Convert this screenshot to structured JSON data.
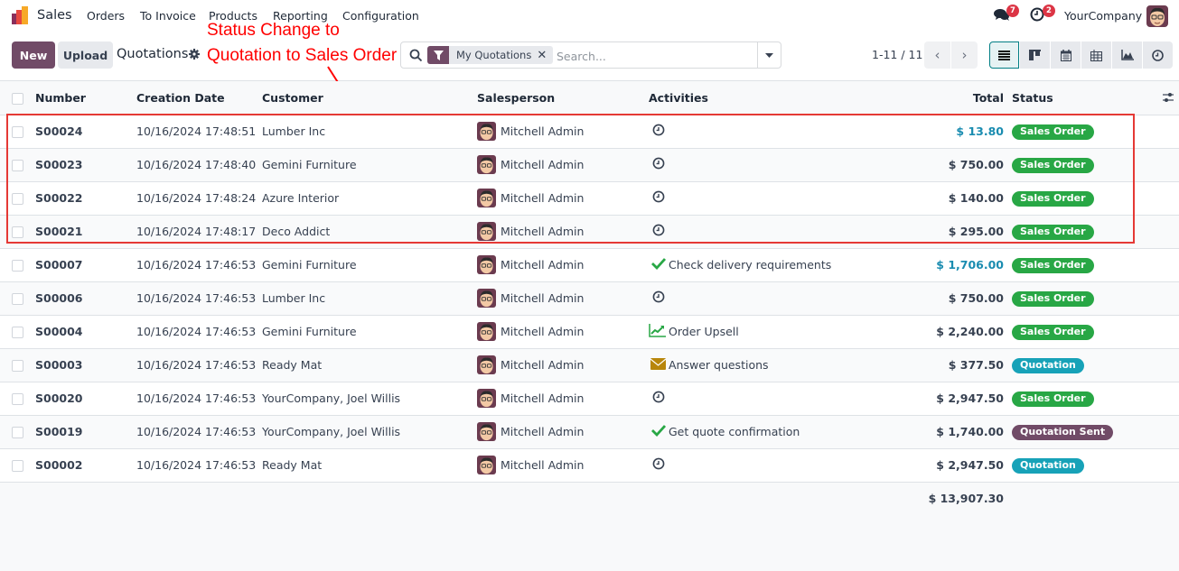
{
  "topbar": {
    "app_name": "Sales",
    "menu": [
      "Orders",
      "To Invoice",
      "Products",
      "Reporting",
      "Configuration"
    ],
    "messages_badge": "7",
    "activities_badge": "2",
    "company": "YourCompany",
    "icons": [
      "app-logo-icon",
      "chat-icon",
      "clock-icon",
      "user-avatar"
    ]
  },
  "control": {
    "new_label": "New",
    "upload_label": "Upload",
    "breadcrumb": "Quotations",
    "search": {
      "facet_label": "My Quotations",
      "facet_close": "✕",
      "placeholder": "Search..."
    },
    "pager": "1-11 / 11",
    "pager_prev": "‹",
    "pager_next": "›",
    "views": [
      "list",
      "kanban",
      "calendar",
      "pivot",
      "graph",
      "activity"
    ],
    "active_view": "list"
  },
  "annotation": {
    "line1": "Status Change to",
    "line2": "Quotation to Sales Order",
    "color": "#ff0000"
  },
  "table": {
    "headers": {
      "number": "Number",
      "date": "Creation Date",
      "customer": "Customer",
      "salesperson": "Salesperson",
      "activities": "Activities",
      "total": "Total",
      "status": "Status"
    },
    "rows": [
      {
        "number": "S00024",
        "date": "10/16/2024 17:48:51",
        "customer": "Lumber Inc",
        "salesperson": "Mitchell Admin",
        "activity": "",
        "activity_icon": "clock",
        "total": "$ 13.80",
        "total_highlight": true,
        "status": "Sales Order",
        "status_color": "green"
      },
      {
        "number": "S00023",
        "date": "10/16/2024 17:48:40",
        "customer": "Gemini Furniture",
        "salesperson": "Mitchell Admin",
        "activity": "",
        "activity_icon": "clock",
        "total": "$ 750.00",
        "total_highlight": false,
        "status": "Sales Order",
        "status_color": "green"
      },
      {
        "number": "S00022",
        "date": "10/16/2024 17:48:24",
        "customer": "Azure Interior",
        "salesperson": "Mitchell Admin",
        "activity": "",
        "activity_icon": "clock",
        "total": "$ 140.00",
        "total_highlight": false,
        "status": "Sales Order",
        "status_color": "green"
      },
      {
        "number": "S00021",
        "date": "10/16/2024 17:48:17",
        "customer": "Deco Addict",
        "salesperson": "Mitchell Admin",
        "activity": "",
        "activity_icon": "clock",
        "total": "$ 295.00",
        "total_highlight": false,
        "status": "Sales Order",
        "status_color": "green"
      },
      {
        "number": "S00007",
        "date": "10/16/2024 17:46:53",
        "customer": "Gemini Furniture",
        "salesperson": "Mitchell Admin",
        "activity": "Check delivery requirements",
        "activity_icon": "check",
        "total": "$ 1,706.00",
        "total_highlight": true,
        "status": "Sales Order",
        "status_color": "green"
      },
      {
        "number": "S00006",
        "date": "10/16/2024 17:46:53",
        "customer": "Lumber Inc",
        "salesperson": "Mitchell Admin",
        "activity": "",
        "activity_icon": "clock",
        "total": "$ 750.00",
        "total_highlight": false,
        "status": "Sales Order",
        "status_color": "green"
      },
      {
        "number": "S00004",
        "date": "10/16/2024 17:46:53",
        "customer": "Gemini Furniture",
        "salesperson": "Mitchell Admin",
        "activity": "Order Upsell",
        "activity_icon": "chart",
        "total": "$ 2,240.00",
        "total_highlight": false,
        "status": "Sales Order",
        "status_color": "green"
      },
      {
        "number": "S00003",
        "date": "10/16/2024 17:46:53",
        "customer": "Ready Mat",
        "salesperson": "Mitchell Admin",
        "activity": "Answer questions",
        "activity_icon": "envelope",
        "total": "$ 377.50",
        "total_highlight": false,
        "status": "Quotation",
        "status_color": "teal"
      },
      {
        "number": "S00020",
        "date": "10/16/2024 17:46:53",
        "customer": "YourCompany, Joel Willis",
        "salesperson": "Mitchell Admin",
        "activity": "",
        "activity_icon": "clock",
        "total": "$ 2,947.50",
        "total_highlight": false,
        "status": "Sales Order",
        "status_color": "green"
      },
      {
        "number": "S00019",
        "date": "10/16/2024 17:46:53",
        "customer": "YourCompany, Joel Willis",
        "salesperson": "Mitchell Admin",
        "activity": "Get quote confirmation",
        "activity_icon": "check",
        "total": "$ 1,740.00",
        "total_highlight": false,
        "status": "Quotation Sent",
        "status_color": "purple"
      },
      {
        "number": "S00002",
        "date": "10/16/2024 17:46:53",
        "customer": "Ready Mat",
        "salesperson": "Mitchell Admin",
        "activity": "",
        "activity_icon": "clock",
        "total": "$ 2,947.50",
        "total_highlight": false,
        "status": "Quotation",
        "status_color": "teal"
      }
    ],
    "grand_total": "$ 13,907.30"
  },
  "colors": {
    "brand": "#714b67",
    "sales_order": "#28a745",
    "quotation": "#17a2b8",
    "quotation_sent": "#714b67",
    "highlight_total": "#1a8cb0",
    "annotation_box": "#e53935"
  }
}
